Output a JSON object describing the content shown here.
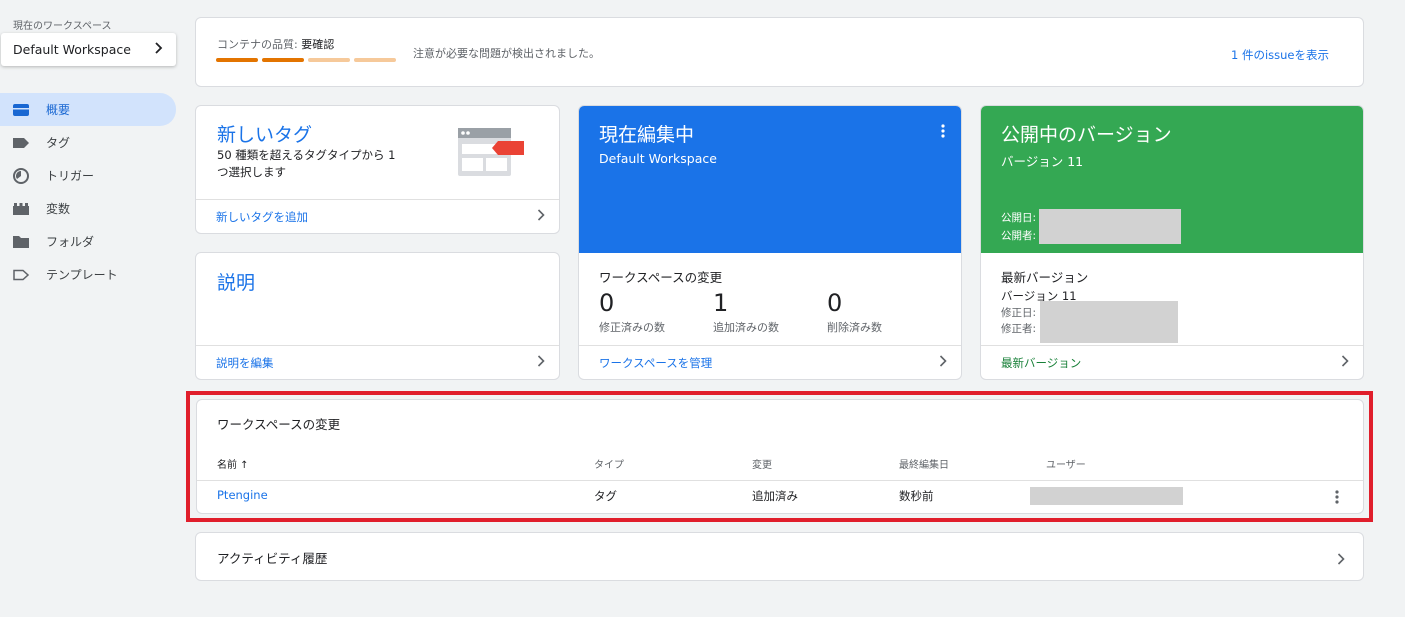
{
  "sidebar": {
    "workspace_label": "現在のワークスペース",
    "workspace_name": "Default Workspace",
    "items": [
      {
        "label": "概要",
        "icon": "overview-icon"
      },
      {
        "label": "タグ",
        "icon": "tag-icon"
      },
      {
        "label": "トリガー",
        "icon": "trigger-icon"
      },
      {
        "label": "変数",
        "icon": "variable-icon"
      },
      {
        "label": "フォルダ",
        "icon": "folder-icon"
      },
      {
        "label": "テンプレート",
        "icon": "template-icon"
      }
    ]
  },
  "quality": {
    "label": "コンテナの品質:",
    "status": "要確認",
    "message": "注意が必要な問題が検出されました。",
    "link": "1 件のissueを表示",
    "bar_colors": [
      "#e37400",
      "#e37400",
      "#f6c99a",
      "#f6c99a"
    ]
  },
  "new_tag": {
    "title": "新しいタグ",
    "desc": "50 種類を超えるタグタイプから 1 つ選択します",
    "link": "新しいタグを追加"
  },
  "description": {
    "title": "説明",
    "link": "説明を編集"
  },
  "editing": {
    "title": "現在編集中",
    "subtitle": "Default Workspace",
    "changes_title": "ワークスペースの変更",
    "stats": [
      {
        "value": "0",
        "label": "修正済みの数"
      },
      {
        "value": "1",
        "label": "追加済みの数"
      },
      {
        "value": "0",
        "label": "削除済み数"
      }
    ],
    "link": "ワークスペースを管理",
    "color": "#1a73e8"
  },
  "published": {
    "title": "公開中のバージョン",
    "subtitle": "バージョン 11",
    "published_date_label": "公開日:",
    "published_by_label": "公開者:",
    "latest_title": "最新バージョン",
    "latest_version": "バージョン 11",
    "modified_date_label": "修正日:",
    "modified_by_label": "修正者:",
    "link": "最新バージョン",
    "color": "#34a853"
  },
  "changes": {
    "title": "ワークスペースの変更",
    "columns": [
      "名前 ↑",
      "タイプ",
      "変更",
      "最終編集日",
      "ユーザー"
    ],
    "rows": [
      {
        "name": "Ptengine",
        "type": "タグ",
        "change": "追加済み",
        "edited": "数秒前"
      }
    ]
  },
  "activity": {
    "title": "アクティビティ履歴"
  }
}
